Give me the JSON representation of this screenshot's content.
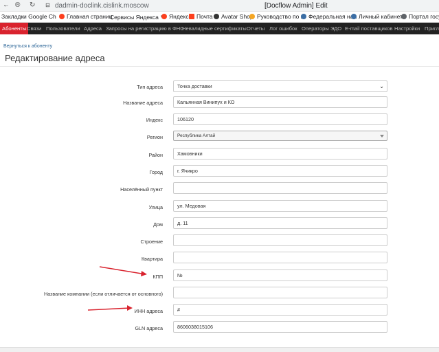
{
  "browser": {
    "url": "dadmin-doclink.cislink.moscow",
    "window_title": "[Docflow Admin] Edit",
    "bookmarks": [
      {
        "label": "Закладки Google Ch",
        "color": "#ffffff"
      },
      {
        "label": "Главная страниц",
        "color": "#fc3f1d"
      },
      {
        "label": "Сервисы Яндекса",
        "color": "#ffffff"
      },
      {
        "label": "Яндекс",
        "color": "#fc3f1d"
      },
      {
        "label": "Почта",
        "color": "#fc3f1d"
      },
      {
        "label": "Avatar Shop",
        "color": "#333333"
      },
      {
        "label": "Руководство по п",
        "color": "#f5a623"
      },
      {
        "label": "Федеральная нал",
        "color": "#3b6ea5"
      },
      {
        "label": "Личный кабинет",
        "color": "#3b6ea5"
      },
      {
        "label": "Портал госус",
        "color": "#5f6368"
      }
    ]
  },
  "navbar": {
    "items": [
      "Абоненты",
      "Связи",
      "Пользователи",
      "Адреса",
      "Запросы на регистрацию в ФНС",
      "Невалидные сертификаты",
      "Отчеты",
      "Лог ошибок",
      "Операторы ЭДО",
      "E-mail поставщиков",
      "Настройки",
      "Пригла"
    ]
  },
  "page": {
    "back_link": "Вернуться к абоненту",
    "title": "Редактирование адреса"
  },
  "form": {
    "fields": [
      {
        "label": "Тип адреса",
        "value": "Точка доставки"
      },
      {
        "label": "Название адреса",
        "value": "Кальянная Винипух и КО"
      },
      {
        "label": "Индекс",
        "value": "106120"
      },
      {
        "label": "Регион",
        "value": "Республика Алтай"
      },
      {
        "label": "Район",
        "value": "Хамовники"
      },
      {
        "label": "Город",
        "value": "г. Ячикро"
      },
      {
        "label": "Населённый пункт",
        "value": ""
      },
      {
        "label": "Улица",
        "value": "ул. Медовая"
      },
      {
        "label": "Дом",
        "value": "д. 11"
      },
      {
        "label": "Строение",
        "value": ""
      },
      {
        "label": "Квартира",
        "value": ""
      },
      {
        "label": "КПП",
        "value": "№"
      },
      {
        "label": "Название компании (если отличается от основного)",
        "value": ""
      },
      {
        "label": "ИНН адреса",
        "value": "#"
      },
      {
        "label": "GLN адреса",
        "value": "8606038015106"
      }
    ]
  },
  "colors": {
    "accent": "#d9232e",
    "navbar": "#222222"
  }
}
